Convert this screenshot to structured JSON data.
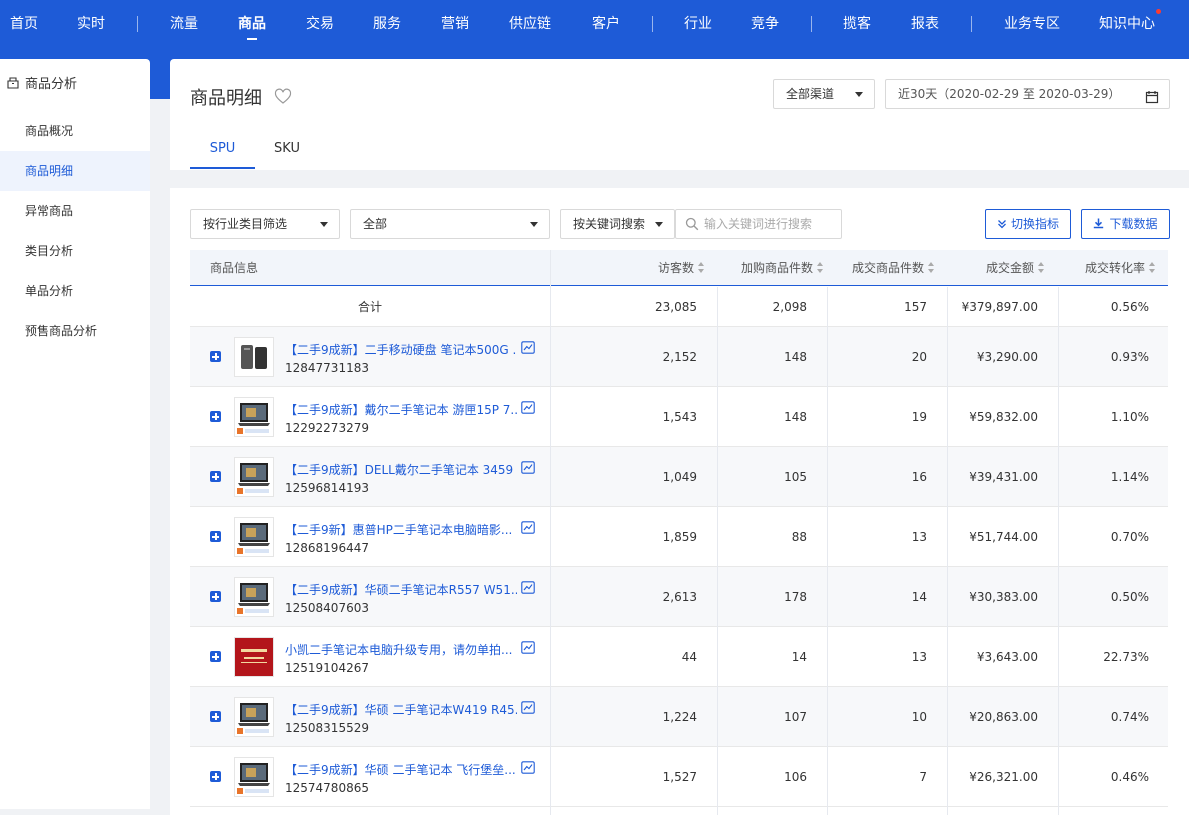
{
  "topnav": {
    "items": [
      "首页",
      "实时",
      "流量",
      "商品",
      "交易",
      "服务",
      "营销",
      "供应链",
      "客户",
      "行业",
      "竞争",
      "揽客",
      "报表",
      "业务专区",
      "知识中心"
    ],
    "active_index": 3
  },
  "sidebar": {
    "title": "商品分析",
    "items": [
      "商品概况",
      "商品明细",
      "异常商品",
      "类目分析",
      "单品分析",
      "预售商品分析"
    ],
    "active_index": 1
  },
  "header": {
    "title": "商品明细",
    "channel": "全部渠道",
    "date_range": "近30天（2020-02-29 至 2020-03-29）",
    "tabs": [
      "SPU",
      "SKU"
    ],
    "active_tab": 0
  },
  "filters": {
    "category_filter": "按行业类目筛选",
    "category_value": "全部",
    "keyword_mode": "按关键词搜索",
    "search_placeholder": "输入关键词进行搜索",
    "switch_metrics": "切换指标",
    "download": "下载数据"
  },
  "table": {
    "columns": [
      "商品信息",
      "访客数",
      "加购商品件数",
      "成交商品件数",
      "成交金额",
      "成交转化率"
    ],
    "total": {
      "label": "合计",
      "visitors": "23,085",
      "cart": "2,098",
      "sold": "157",
      "amount": "¥379,897.00",
      "rate": "0.56%"
    },
    "rows": [
      {
        "title": "【二手9成新】二手移动硬盘 笔记本500G ...",
        "id": "12847731183",
        "visitors": "2,152",
        "cart": "148",
        "sold": "20",
        "amount": "¥3,290.00",
        "rate": "0.93%",
        "thumb": "hdd"
      },
      {
        "title": "【二手9成新】戴尔二手笔记本 游匣15P 7...",
        "id": "12292273279",
        "visitors": "1,543",
        "cart": "148",
        "sold": "19",
        "amount": "¥59,832.00",
        "rate": "1.10%",
        "thumb": "laptop"
      },
      {
        "title": "【二手9成新】DELL戴尔二手笔记本 3459 ...",
        "id": "12596814193",
        "visitors": "1,049",
        "cart": "105",
        "sold": "16",
        "amount": "¥39,431.00",
        "rate": "1.14%",
        "thumb": "laptop"
      },
      {
        "title": "【二手9新】惠普HP二手笔记本电脑暗影...",
        "id": "12868196447",
        "visitors": "1,859",
        "cart": "88",
        "sold": "13",
        "amount": "¥51,744.00",
        "rate": "0.70%",
        "thumb": "laptop"
      },
      {
        "title": "【二手9成新】华硕二手笔记本R557 W51...",
        "id": "12508407603",
        "visitors": "2,613",
        "cart": "178",
        "sold": "14",
        "amount": "¥30,383.00",
        "rate": "0.50%",
        "thumb": "laptop"
      },
      {
        "title": "小凯二手笔记本电脑升级专用，请勿单拍...",
        "id": "12519104267",
        "visitors": "44",
        "cart": "14",
        "sold": "13",
        "amount": "¥3,643.00",
        "rate": "22.73%",
        "thumb": "red"
      },
      {
        "title": "【二手9成新】华硕 二手笔记本W419 R45...",
        "id": "12508315529",
        "visitors": "1,224",
        "cart": "107",
        "sold": "10",
        "amount": "¥20,863.00",
        "rate": "0.74%",
        "thumb": "laptop"
      },
      {
        "title": "【二手9成新】华硕 二手笔记本 飞行堡垒...",
        "id": "12574780865",
        "visitors": "1,527",
        "cart": "106",
        "sold": "7",
        "amount": "¥26,321.00",
        "rate": "0.46%",
        "thumb": "laptop"
      }
    ]
  },
  "icons": {
    "sidebar_head": "box-icon",
    "favorite": "heart-outline-icon",
    "calendar": "calendar-icon",
    "search": "search-icon",
    "switch": "double-chevron-down-icon",
    "download": "download-icon",
    "expand": "plus-square-icon",
    "trend": "trend-chart-icon"
  },
  "colors": {
    "primary": "#1e5bd7",
    "nav_bg": "#1e5bd7",
    "notify": "#ff3b30"
  }
}
